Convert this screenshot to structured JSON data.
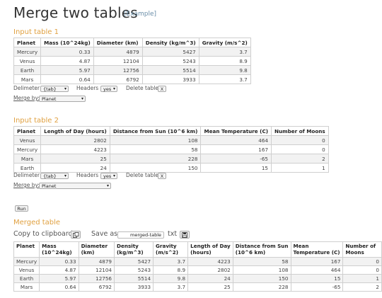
{
  "page": {
    "title": "Merge two tables",
    "example_link": "[Example]"
  },
  "input1": {
    "title": "Input table 1",
    "headers": [
      "Planet",
      "Mass (10^24kg)",
      "Diameter (km)",
      "Density (kg/m^3)",
      "Gravity (m/s^2)"
    ],
    "rows": [
      [
        "Mercury",
        "0.33",
        "4879",
        "5427",
        "3.7"
      ],
      [
        "Venus",
        "4.87",
        "12104",
        "5243",
        "8.9"
      ],
      [
        "Earth",
        "5.97",
        "12756",
        "5514",
        "9.8"
      ],
      [
        "Mars",
        "0.64",
        "6792",
        "3933",
        "3.7"
      ]
    ],
    "delimiter_label": "Delimeter",
    "delimiter_value": "{tab}",
    "headers_label": "Headers",
    "headers_value": "yes",
    "delete_label": "Delete table",
    "delete_btn": "X",
    "merge_by_label": "Merge by:",
    "merge_by_value": "Planet"
  },
  "input2": {
    "title": "Input table 2",
    "headers": [
      "Planet",
      "Length of Day (hours)",
      "Distance from Sun (10^6 km)",
      "Mean Temperature (C)",
      "Number of Moons"
    ],
    "rows": [
      [
        "Venus",
        "2802",
        "108",
        "464",
        "0"
      ],
      [
        "Mercury",
        "4223",
        "58",
        "167",
        "0"
      ],
      [
        "Mars",
        "25",
        "228",
        "-65",
        "2"
      ],
      [
        "Earth",
        "24",
        "150",
        "15",
        "1"
      ]
    ],
    "delimiter_label": "Delimeter",
    "delimiter_value": "{tab}",
    "headers_label": "Headers",
    "headers_value": "yes",
    "delete_label": "Delete table",
    "delete_btn": "X",
    "merge_by_label": "Merge by:",
    "merge_by_value": "Planet"
  },
  "run_button": "Run",
  "merged": {
    "title": "Merged table",
    "copy_label": "Copy to clipboard",
    "save_as_label": "Save as",
    "filename": "merged-table",
    "ext_label": "txt",
    "headers": [
      [
        "Planet"
      ],
      [
        "Mass",
        "(10^24kg)"
      ],
      [
        "Diameter",
        "(km)"
      ],
      [
        "Density",
        "(kg/m^3)"
      ],
      [
        "Gravity",
        "(m/s^2)"
      ],
      [
        "Length of Day",
        "(hours)"
      ],
      [
        "Distance from Sun",
        "(10^6 km)"
      ],
      [
        "Mean",
        "Temperature (C)"
      ],
      [
        "Number of",
        "Moons"
      ]
    ],
    "rows": [
      [
        "Mercury",
        "0.33",
        "4879",
        "5427",
        "3.7",
        "4223",
        "58",
        "167",
        "0"
      ],
      [
        "Venus",
        "4.87",
        "12104",
        "5243",
        "8.9",
        "2802",
        "108",
        "464",
        "0"
      ],
      [
        "Earth",
        "5.97",
        "12756",
        "5514",
        "9.8",
        "24",
        "150",
        "15",
        "1"
      ],
      [
        "Mars",
        "0.64",
        "6792",
        "3933",
        "3.7",
        "25",
        "228",
        "-65",
        "2"
      ]
    ]
  }
}
